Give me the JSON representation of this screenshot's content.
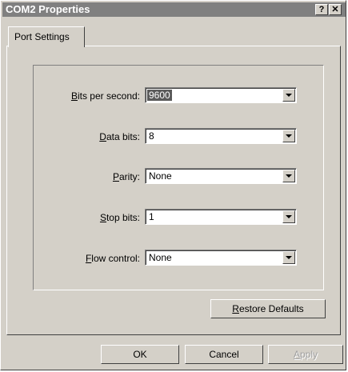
{
  "window": {
    "title": "COM2 Properties",
    "help_glyph": "?",
    "close_glyph": "✕"
  },
  "tabs": [
    {
      "label": "Port Settings"
    }
  ],
  "settings": [
    {
      "label_acc": "B",
      "label_rest": "its per second:",
      "value": "9600"
    },
    {
      "label_acc": "D",
      "label_rest": "ata bits:",
      "value": "8"
    },
    {
      "label_pre": "",
      "label_acc": "P",
      "label_rest": "arity:",
      "value": "None"
    },
    {
      "label_acc": "S",
      "label_rest": "top bits:",
      "value": "1"
    },
    {
      "label_acc": "F",
      "label_rest": "low control:",
      "value": "None"
    }
  ],
  "buttons": {
    "restore_acc": "R",
    "restore_rest": "estore Defaults",
    "ok": "OK",
    "cancel": "Cancel",
    "apply_acc": "A",
    "apply_rest": "pply"
  },
  "icons": {
    "dropdown": "chevron-down-icon",
    "help": "help-icon",
    "close": "close-icon"
  }
}
